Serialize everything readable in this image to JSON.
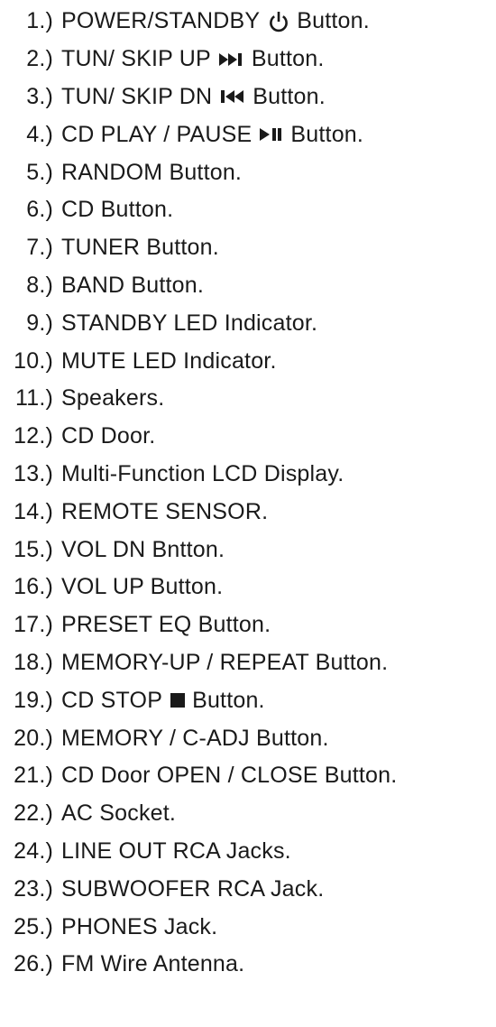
{
  "items": [
    {
      "num": "1.)",
      "pre": "POWER/STANDBY",
      "icon": "power-icon",
      "post": "Button."
    },
    {
      "num": "2.)",
      "pre": "TUN/ SKIP UP",
      "icon": "skip-forward-icon",
      "post": "Button."
    },
    {
      "num": "3.)",
      "pre": "TUN/ SKIP DN",
      "icon": "skip-back-icon",
      "post": "Button."
    },
    {
      "num": "4.)",
      "pre": "CD PLAY / PAUSE",
      "icon": "play-pause-icon",
      "post": "Button."
    },
    {
      "num": "5.)",
      "pre": "RANDOM Button."
    },
    {
      "num": "6.)",
      "pre": "CD Button."
    },
    {
      "num": "7.)",
      "pre": "TUNER Button."
    },
    {
      "num": "8.)",
      "pre": "BAND Button."
    },
    {
      "num": "9.)",
      "pre": "STANDBY LED Indicator."
    },
    {
      "num": "10.)",
      "pre": "MUTE LED Indicator."
    },
    {
      "num": "11.)",
      "pre": "Speakers."
    },
    {
      "num": "12.)",
      "pre": "CD Door."
    },
    {
      "num": "13.)",
      "pre": "Multi-Function LCD Display."
    },
    {
      "num": "14.)",
      "pre": "REMOTE SENSOR."
    },
    {
      "num": "15.)",
      "pre": "VOL DN Bntton."
    },
    {
      "num": "16.)",
      "pre": "VOL UP Button."
    },
    {
      "num": "17.)",
      "pre": "PRESET EQ Button."
    },
    {
      "num": "18.)",
      "pre": "MEMORY-UP / REPEAT Button."
    },
    {
      "num": "19.)",
      "pre": "CD STOP",
      "icon": "stop-icon",
      "post": "Button."
    },
    {
      "num": "20.)",
      "pre": "MEMORY / C-ADJ Button."
    },
    {
      "num": "21.)",
      "pre": "CD Door OPEN / CLOSE Button."
    },
    {
      "num": "22.)",
      "pre": "AC Socket."
    },
    {
      "num": "24.)",
      "pre": "LINE OUT RCA Jacks."
    },
    {
      "num": "23.)",
      "pre": "SUBWOOFER RCA Jack."
    },
    {
      "num": "25.)",
      "pre": "PHONES Jack."
    },
    {
      "num": "26.)",
      "pre": "FM Wire Antenna."
    }
  ]
}
